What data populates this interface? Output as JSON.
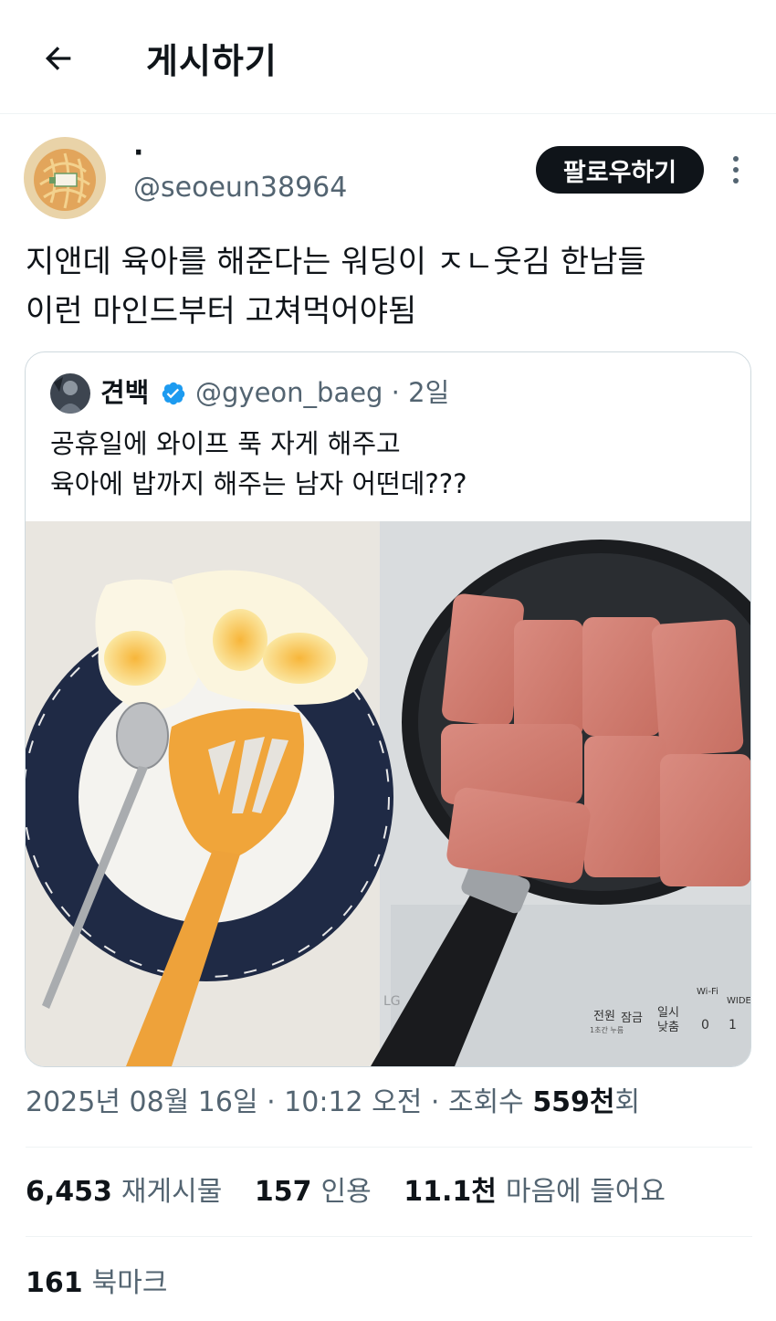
{
  "header": {
    "title": "게시하기"
  },
  "author": {
    "display_name": "·",
    "handle": "@seoeun38964",
    "follow_label": "팔로우하기"
  },
  "tweet": {
    "lines": [
      "지앤데 육아를 해준다는 워딩이 ㅈㄴ웃김 한남들",
      "이런 마인드부터 고쳐먹어야됨"
    ]
  },
  "quote": {
    "name": "견백",
    "handle_time": "@gyeon_baeg · 2일",
    "lines": [
      "공휴일에 와이프 푹 자게 해주고",
      "육아에 밥까지 해주는 남자 어떤데???"
    ],
    "image_panel_labels": {
      "wifi": "Wi-Fi",
      "wide": "WIDE",
      "power": "전원",
      "power_sub": "1초간 누름",
      "lock": "잠금",
      "pause": "일시",
      "pause2": "낮춤",
      "zero": "0",
      "one": "1",
      "brand": "LG"
    }
  },
  "meta": {
    "datetime": "2025년 08월 16일 · 10:12 오전 · 조회수 ",
    "views": "559천",
    "views_suffix": "회"
  },
  "stats": {
    "retweets_count": "6,453",
    "retweets_label": "재게시물",
    "quotes_count": "157",
    "quotes_label": "인용",
    "likes_count": "11.1천",
    "likes_label": "마음에 들어요",
    "bookmarks_count": "161",
    "bookmarks_label": "북마크"
  },
  "colors": {
    "text": "#0f1419",
    "secondary": "#536471",
    "verified": "#1d9bf0",
    "border": "#cfd9de"
  }
}
